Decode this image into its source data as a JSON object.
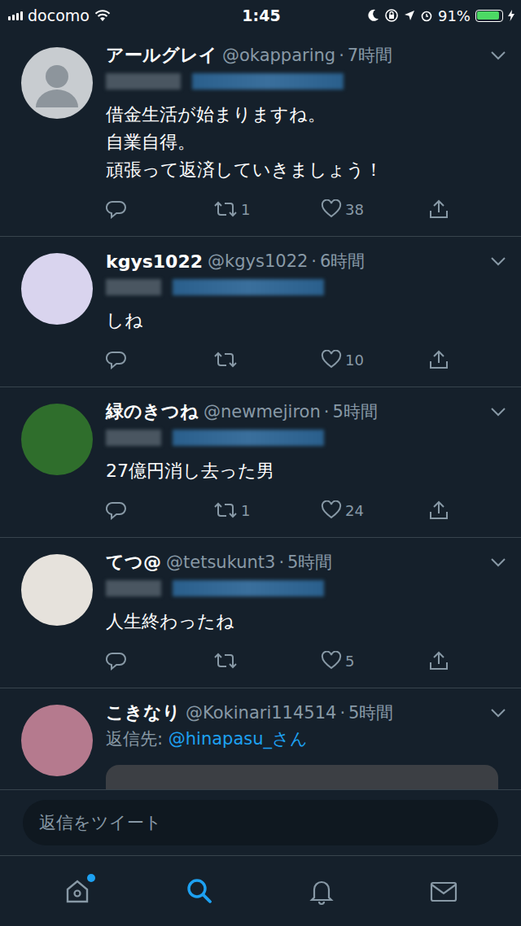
{
  "status_bar": {
    "carrier": "docomo",
    "time": "1:45",
    "battery": "91%",
    "battery_level": 0.91,
    "charging": true
  },
  "meta_separator": "·",
  "tweets": [
    {
      "name": "アールグレイ",
      "handle": "@okapparing",
      "time": "7時間",
      "avatar": "default",
      "reply_blurred": true,
      "reply_label": "",
      "reply_handle": "",
      "text": [
        "借金生活が始まりますね。",
        "自業自得。",
        "頑張って返済していきましょう！"
      ],
      "retweets": "1",
      "likes": "38",
      "media": false
    },
    {
      "name": "kgys1022",
      "handle": "@kgys1022",
      "time": "6時間",
      "avatar": "photo",
      "reply_blurred": true,
      "reply_label": "",
      "reply_handle": "",
      "text": [
        "しね"
      ],
      "retweets": "",
      "likes": "10",
      "media": false
    },
    {
      "name": "緑のきつね",
      "handle": "@newmejiron",
      "time": "5時間",
      "avatar": "photo",
      "reply_blurred": true,
      "reply_label": "",
      "reply_handle": "",
      "text": [
        "27億円消し去った男"
      ],
      "retweets": "1",
      "likes": "24",
      "media": false
    },
    {
      "name": "てつ@",
      "handle": "@tetsukunt3",
      "time": "5時間",
      "avatar": "photo",
      "reply_blurred": true,
      "reply_label": "",
      "reply_handle": "",
      "text": [
        "人生終わったね"
      ],
      "retweets": "",
      "likes": "5",
      "media": false
    },
    {
      "name": "こきなり",
      "handle": "@Kokinari114514",
      "time": "5時間",
      "avatar": "photo",
      "reply_blurred": false,
      "reply_label": "返信先:",
      "reply_handle": "@hinapasu_さん",
      "text": [],
      "retweets": "",
      "likes": "",
      "media": true
    }
  ],
  "reply_bar": {
    "placeholder": "返信をツイート"
  },
  "tabs": [
    {
      "name": "home",
      "selected": false,
      "badge": true
    },
    {
      "name": "search",
      "selected": true,
      "badge": false
    },
    {
      "name": "notifications",
      "selected": false,
      "badge": false
    },
    {
      "name": "messages",
      "selected": false,
      "badge": false
    }
  ]
}
